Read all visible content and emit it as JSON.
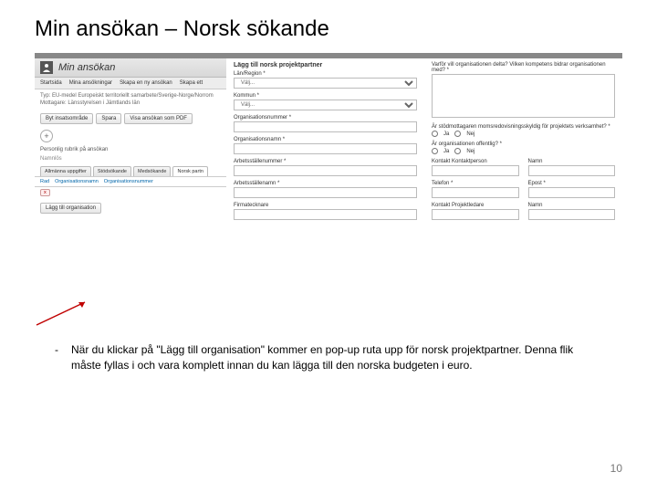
{
  "title": "Min ansökan – Norsk sökande",
  "header": {
    "app_name": "Min ansökan"
  },
  "menu": {
    "startsida": "Startsida",
    "mina": "Mina ansökningar",
    "skapa": "Skapa en ny ansökan",
    "nytt": "Skapa ett"
  },
  "meta": {
    "typ": "Typ: EU-medel Europeiskt territoriellt samarbete/Sverige-Norge/Norrom",
    "mottagare": "Mottagare: Länsstyrelsen i Jämtlands län"
  },
  "toolbar": {
    "byt": "Byt insatsområde",
    "spara": "Spara",
    "pdf": "Visa ansökan som PDF"
  },
  "section": {
    "rubrik": "Personlig rubrik på ansökan",
    "namnlos": "Namnlös"
  },
  "tabs": {
    "t1": "Allmänna uppgifter",
    "t2": "Stödsökande",
    "t3": "Medsökande",
    "t4": "Norsk partn"
  },
  "table": {
    "c1": "Rad",
    "c2": "Organisationsnamn",
    "c3": "Organisationsnummer",
    "del": "x"
  },
  "addorg": {
    "label": "Lägg till organisation"
  },
  "popup": {
    "title": "Lägg till norsk projektpartner",
    "lan": "Län/Region *",
    "lan_val": "Välj...",
    "kommun": "Kommun *",
    "kommun_val": "Välj...",
    "orgnr": "Organisationsnummer *",
    "orgnamn": "Organisationsnamn *",
    "arbnr": "Arbetsställenummer *",
    "arbnamn": "Arbetsställenamn *",
    "firma": "Firmatecknare",
    "varfor": "Varför vill organisationen delta? Vilken kompetens bidrar organisationen med? *",
    "moms": "Är stödmottagaren momsredovisningsskyldig för projektets verksamhet? *",
    "offentlig": "Är organisationen offentlig? *",
    "ja": "Ja",
    "nej": "Nej",
    "kontakt_kp": "Kontakt Kontaktperson",
    "namn": "Namn",
    "telefon": "Telefon *",
    "epost": "Epost *",
    "kontakt_pl": "Kontakt Projektledare"
  },
  "bullet": "När du klickar på \"Lägg till organisation\" kommer en  pop-up ruta upp för norsk projektpartner.  Denna flik måste fyllas i och vara komplett innan du kan lägga till den norska budgeten i euro.",
  "page": "10"
}
